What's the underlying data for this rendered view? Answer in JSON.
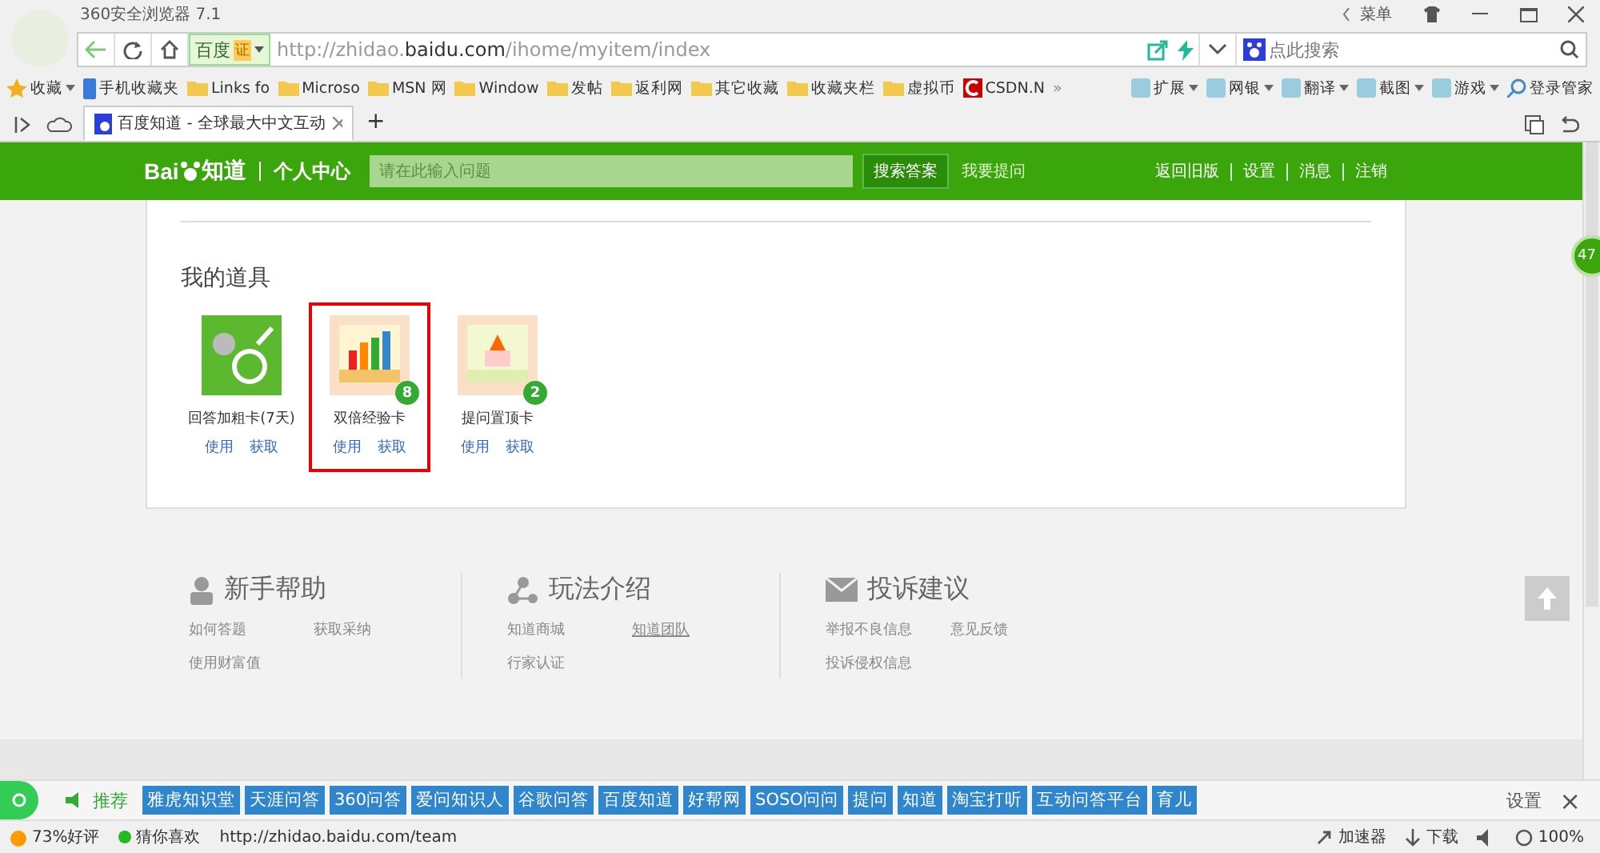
{
  "window": {
    "title": "360安全浏览器 7.1",
    "menu": "菜单"
  },
  "address_bar": {
    "site_label": "百度",
    "cert": "证",
    "url_prefix": "http://zhidao.",
    "url_domain": "baidu.com",
    "url_path": "/ihome/myitem/index",
    "search_placeholder": "点此搜索"
  },
  "bookmarks": [
    {
      "label": "收藏",
      "kind": "star"
    },
    {
      "label": "手机收藏夹",
      "kind": "phone"
    },
    {
      "label": "Links fo",
      "kind": "folder"
    },
    {
      "label": "Microso",
      "kind": "folder"
    },
    {
      "label": "MSN 网",
      "kind": "folder"
    },
    {
      "label": "Window",
      "kind": "folder"
    },
    {
      "label": "发帖",
      "kind": "folder"
    },
    {
      "label": "返利网",
      "kind": "folder"
    },
    {
      "label": "其它收藏",
      "kind": "folder"
    },
    {
      "label": "收藏夹栏",
      "kind": "folder"
    },
    {
      "label": "虚拟币",
      "kind": "folder"
    },
    {
      "label": "CSDN.N",
      "kind": "csdn"
    }
  ],
  "more": "»",
  "extensions": [
    "扩展",
    "网银",
    "翻译",
    "截图",
    "游戏"
  ],
  "login": "登录管家",
  "tabs": [
    {
      "label": "百度知道 - 全球最大中文互动",
      "selected": true
    }
  ],
  "new_tab": "+",
  "site_header": {
    "logo_a": "Bai",
    "logo_b": "知道",
    "section": "个人中心",
    "search_placeholder": "请在此输入问题",
    "search_button": "搜索答案",
    "ask": "我要提问",
    "links": [
      "返回旧版",
      "设置",
      "消息",
      "注销"
    ]
  },
  "tools": {
    "title": "我的道具",
    "items": [
      {
        "name": "回答加粗卡(7天)",
        "kind": "bold",
        "selected": false,
        "actions": [
          "使用",
          "获取"
        ]
      },
      {
        "name": "双倍经验卡",
        "kind": "double",
        "count": "8",
        "selected": true,
        "actions": [
          "使用",
          "获取"
        ]
      },
      {
        "name": "提问置顶卡",
        "kind": "top",
        "count": "2",
        "selected": false,
        "actions": [
          "使用",
          "获取"
        ]
      }
    ]
  },
  "side_badge": "47",
  "footer": [
    {
      "title": "新手帮助",
      "kind": "person",
      "links": [
        {
          "label": "如何答题",
          "underlined": false
        },
        {
          "label": "获取采纳",
          "underlined": false
        },
        {
          "label": "使用财富值",
          "underlined": false
        }
      ]
    },
    {
      "title": "玩法介绍",
      "kind": "share",
      "links": [
        {
          "label": "知道商城",
          "underlined": false
        },
        {
          "label": "知道团队",
          "underlined": true
        },
        {
          "label": "行家认证",
          "underlined": false
        }
      ]
    },
    {
      "title": "投诉建议",
      "kind": "mail",
      "links": [
        {
          "label": "举报不良信息",
          "underlined": false
        },
        {
          "label": "意见反馈",
          "underlined": false
        },
        {
          "label": "投诉侵权信息",
          "underlined": false
        }
      ]
    }
  ],
  "bottom_toolbar": {
    "recommend": "推荐",
    "links": [
      "雅虎知识堂",
      "天涯问答",
      "360问答",
      "爱问知识人",
      "谷歌问答",
      "百度知道",
      "好帮网",
      "SOSO问问",
      "提问",
      "知道",
      "淘宝打听",
      "互动问答平台",
      "育儿"
    ],
    "settings": "设置",
    "close": "×"
  },
  "status_bar": {
    "rating": "73%好评",
    "guess": "猜你喜欢",
    "url": "http://zhidao.baidu.com/team",
    "accelerator": "加速器",
    "download": "下载",
    "zoom": "100%"
  }
}
